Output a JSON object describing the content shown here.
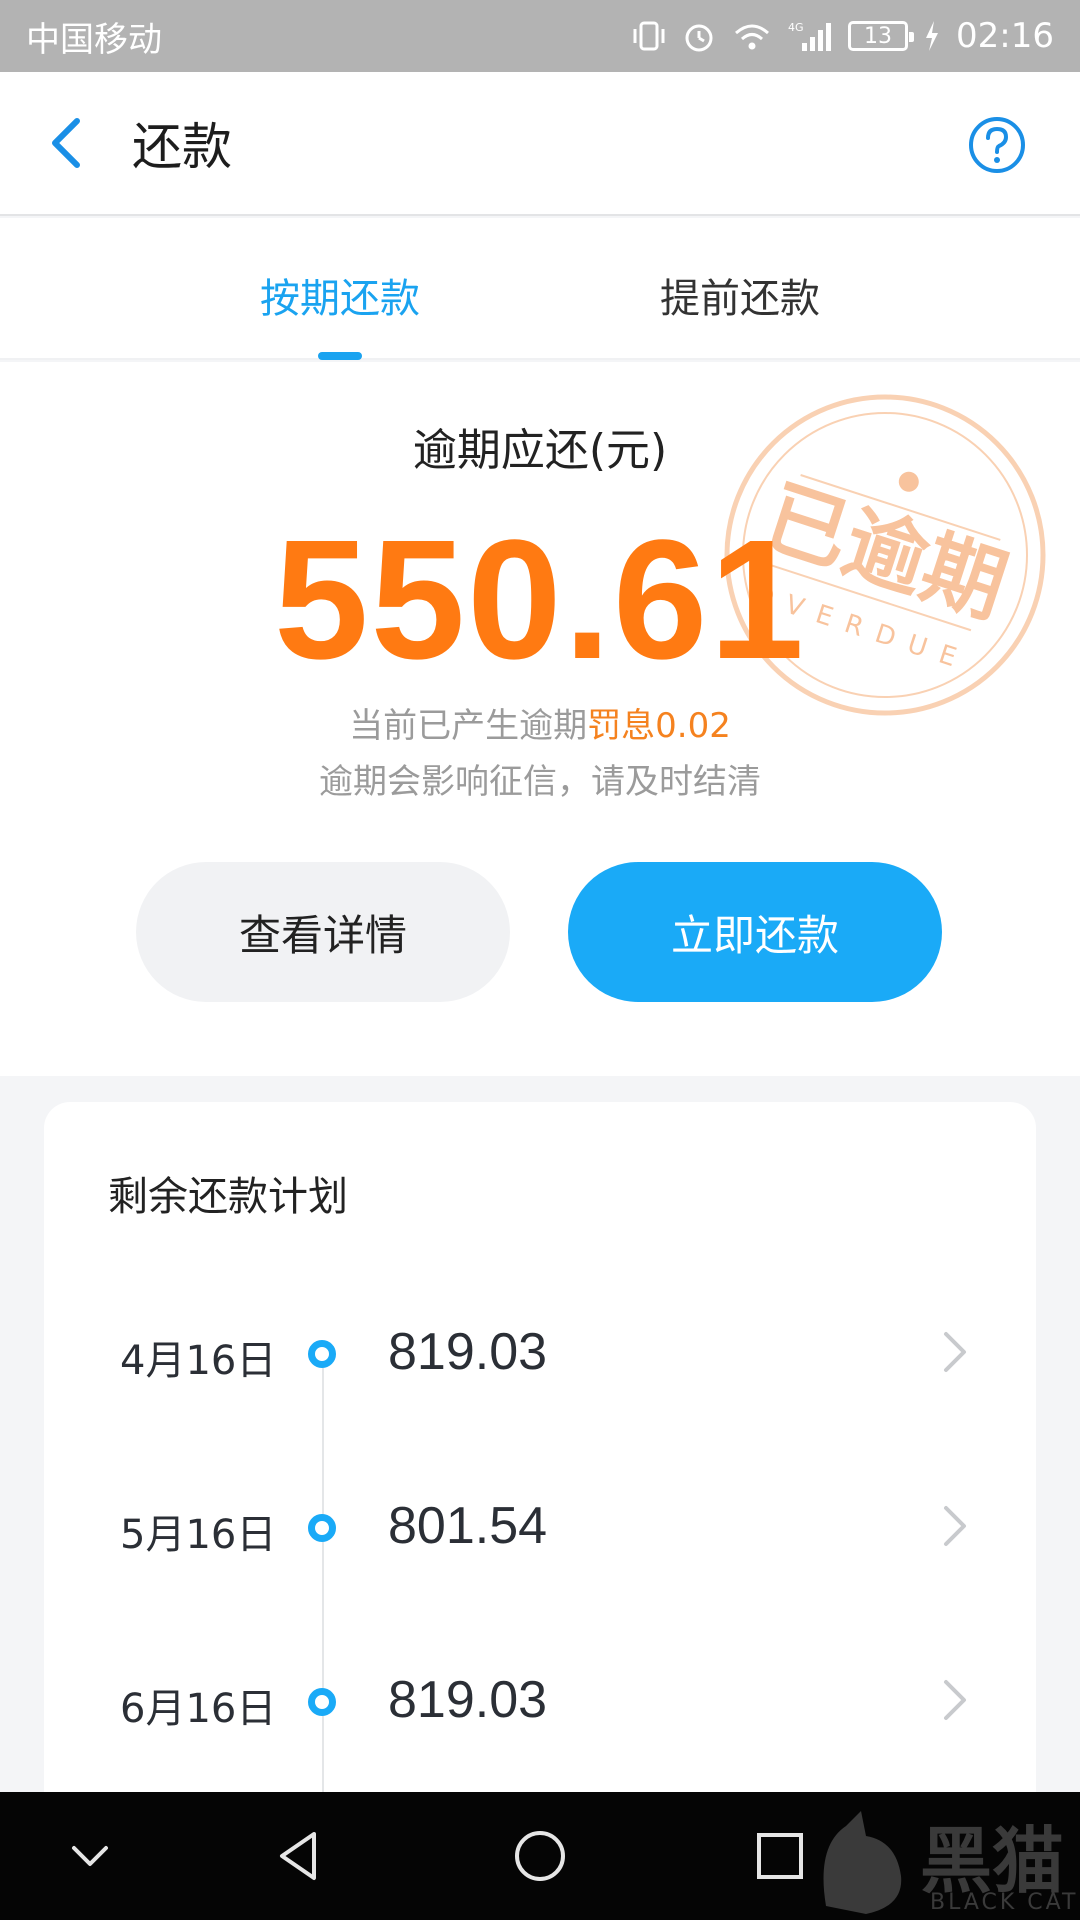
{
  "status_bar": {
    "carrier": "中国移动",
    "network": "4G",
    "battery": "13",
    "time": "02:16"
  },
  "header": {
    "title": "还款",
    "back_icon": "chevron-left-icon",
    "help_icon": "question-circle-icon"
  },
  "tabs": [
    {
      "label": "按期还款",
      "active": true
    },
    {
      "label": "提前还款",
      "active": false
    }
  ],
  "summary": {
    "label": "逾期应还(元)",
    "amount": "550.61",
    "notice_prefix": "当前已产生逾期",
    "notice_penalty": "罚息0.02",
    "notice_line2": "逾期会影响征信，请及时结清",
    "stamp_text": "已逾期",
    "stamp_sub": "OVERDUE"
  },
  "buttons": {
    "detail": "查看详情",
    "pay": "立即还款"
  },
  "plan": {
    "title": "剩余还款计划",
    "rows": [
      {
        "date": "4月16日",
        "amount": "819.03"
      },
      {
        "date": "5月16日",
        "amount": "801.54"
      },
      {
        "date": "6月16日",
        "amount": "819.03"
      }
    ]
  },
  "watermark": {
    "text": "黑猫",
    "sub": "BLACK CAT"
  },
  "colors": {
    "accent": "#1aaaf7",
    "amount": "#ff7a12",
    "penalty": "#f5821f",
    "status_bar": "#b3b3b3"
  }
}
